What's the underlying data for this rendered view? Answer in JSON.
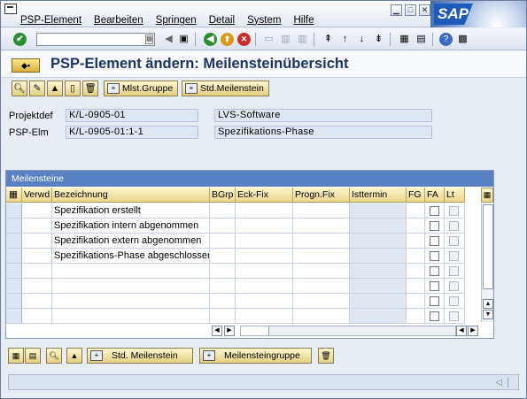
{
  "menu": {
    "items": [
      "PSP-Element",
      "Bearbeiten",
      "Springen",
      "Detail",
      "System",
      "Hilfe"
    ]
  },
  "brand": {
    "logo_text": "SAP"
  },
  "title": "PSP-Element ändern: Meilensteinübersicht",
  "app_toolbar": {
    "mlst_gruppe": "Mlst.Gruppe",
    "std_meilenstein": "Std.Meilenstein"
  },
  "header": {
    "projektdef_label": "Projektdef",
    "projektdef_value": "K/L-0905-01",
    "projektdef_desc": "LVS-Software",
    "pspelm_label": "PSP-Elm",
    "pspelm_value": "K/L-0905-01:1-1",
    "pspelm_desc": "Spezifikations-Phase"
  },
  "table": {
    "title": "Meilensteine",
    "columns": [
      "Verwd",
      "Bezeichnung",
      "BGrp",
      "Eck-Fix",
      "Progn.Fix",
      "Isttermin",
      "FG",
      "FA",
      "Lt"
    ],
    "rows": [
      {
        "bezeichnung": "Spezifikation erstellt"
      },
      {
        "bezeichnung": "Spezifikation intern abgenommen"
      },
      {
        "bezeichnung": "Spezifikation extern abgenommen"
      },
      {
        "bezeichnung": "Spezifikations-Phase abgeschlossen"
      },
      {
        "bezeichnung": ""
      },
      {
        "bezeichnung": ""
      },
      {
        "bezeichnung": ""
      },
      {
        "bezeichnung": ""
      }
    ]
  },
  "bottom_buttons": {
    "std_meilenstein": "Std. Meilenstein",
    "meilensteingruppe": "Meilensteingruppe"
  },
  "colors": {
    "title_text": "#1b3563",
    "table_title_bg": "#5a81c2",
    "header_cell_bg": "#ecd68c"
  }
}
